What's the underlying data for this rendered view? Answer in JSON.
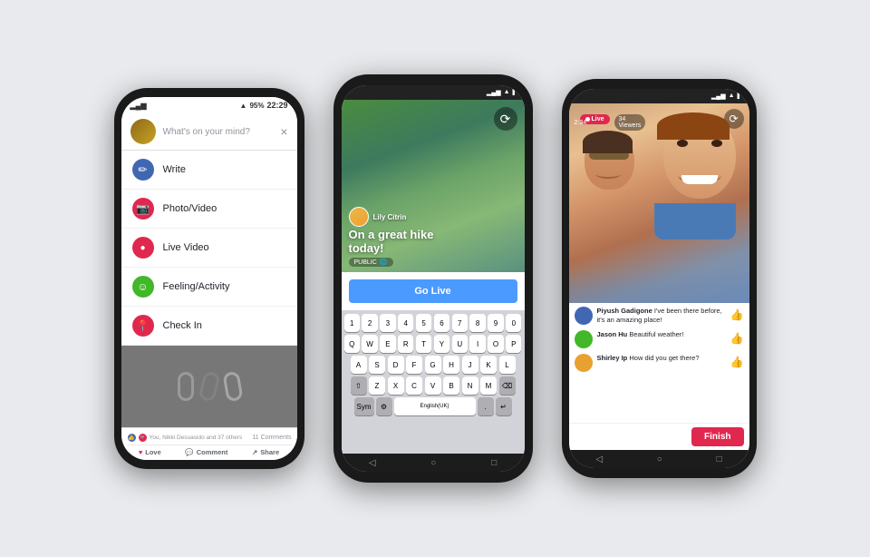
{
  "page": {
    "background": "#e8eaed"
  },
  "phone1": {
    "statusBar": {
      "signal": "▂▄▆",
      "wifi": "WiFi",
      "battery": "95%",
      "time": "22:29"
    },
    "header": {
      "placeholder": "What's on your mind?",
      "closeIcon": "×"
    },
    "menuItems": [
      {
        "icon": "✏",
        "iconBg": "icon-blue",
        "label": "Write"
      },
      {
        "icon": "📷",
        "iconBg": "icon-red-camera",
        "label": "Photo/Video"
      },
      {
        "icon": "📡",
        "iconBg": "icon-red-circle",
        "label": "Live Video"
      },
      {
        "icon": "☺",
        "iconBg": "icon-green",
        "label": "Feeling/Activity"
      },
      {
        "icon": "📍",
        "iconBg": "icon-location",
        "label": "Check In"
      }
    ],
    "footer": {
      "reactions": "You, Nikki Desuasido and 37 others",
      "comments": "11 Comments",
      "actions": [
        "Love",
        "Comment",
        "Share"
      ]
    }
  },
  "phone2": {
    "statusBar": {
      "time": "",
      "icons": ""
    },
    "cameraView": {
      "userName": "Lily Citrin",
      "caption": "On a great hike today!",
      "publicLabel": "PUBLIC",
      "flipIcon": "🔄"
    },
    "goLiveButton": "Go Live",
    "keyboard": {
      "rows": [
        [
          "1",
          "2",
          "3",
          "4",
          "5",
          "6",
          "7",
          "8",
          "9",
          "0"
        ],
        [
          "Q",
          "W",
          "E",
          "R",
          "T",
          "Y",
          "U",
          "I",
          "O",
          "P"
        ],
        [
          "A",
          "S",
          "D",
          "F",
          "G",
          "H",
          "J",
          "K",
          "L"
        ],
        [
          "⇧",
          "Z",
          "X",
          "C",
          "V",
          "B",
          "N",
          "M",
          "⌫"
        ],
        [
          "Sym",
          "⚙",
          "English(UK)",
          ".",
          "↵"
        ]
      ]
    }
  },
  "phone3": {
    "liveBadge": "Live",
    "viewers": "34 Viewers",
    "timer": "2:34",
    "flipIcon": "🔄",
    "comments": [
      {
        "avatar": "#4267B2",
        "name": "Piyush Gadigone",
        "text": "I've been there before, it's an amazing place!",
        "liked": true
      },
      {
        "avatar": "#42b72a",
        "name": "Jason Hu",
        "text": "Beautiful weather!",
        "liked": false
      },
      {
        "avatar": "#e8a030",
        "name": "Shirley Ip",
        "text": "How did you get there?",
        "liked": false
      }
    ],
    "finishButton": "Finish",
    "navIcons": [
      "◁",
      "○",
      "□"
    ]
  }
}
